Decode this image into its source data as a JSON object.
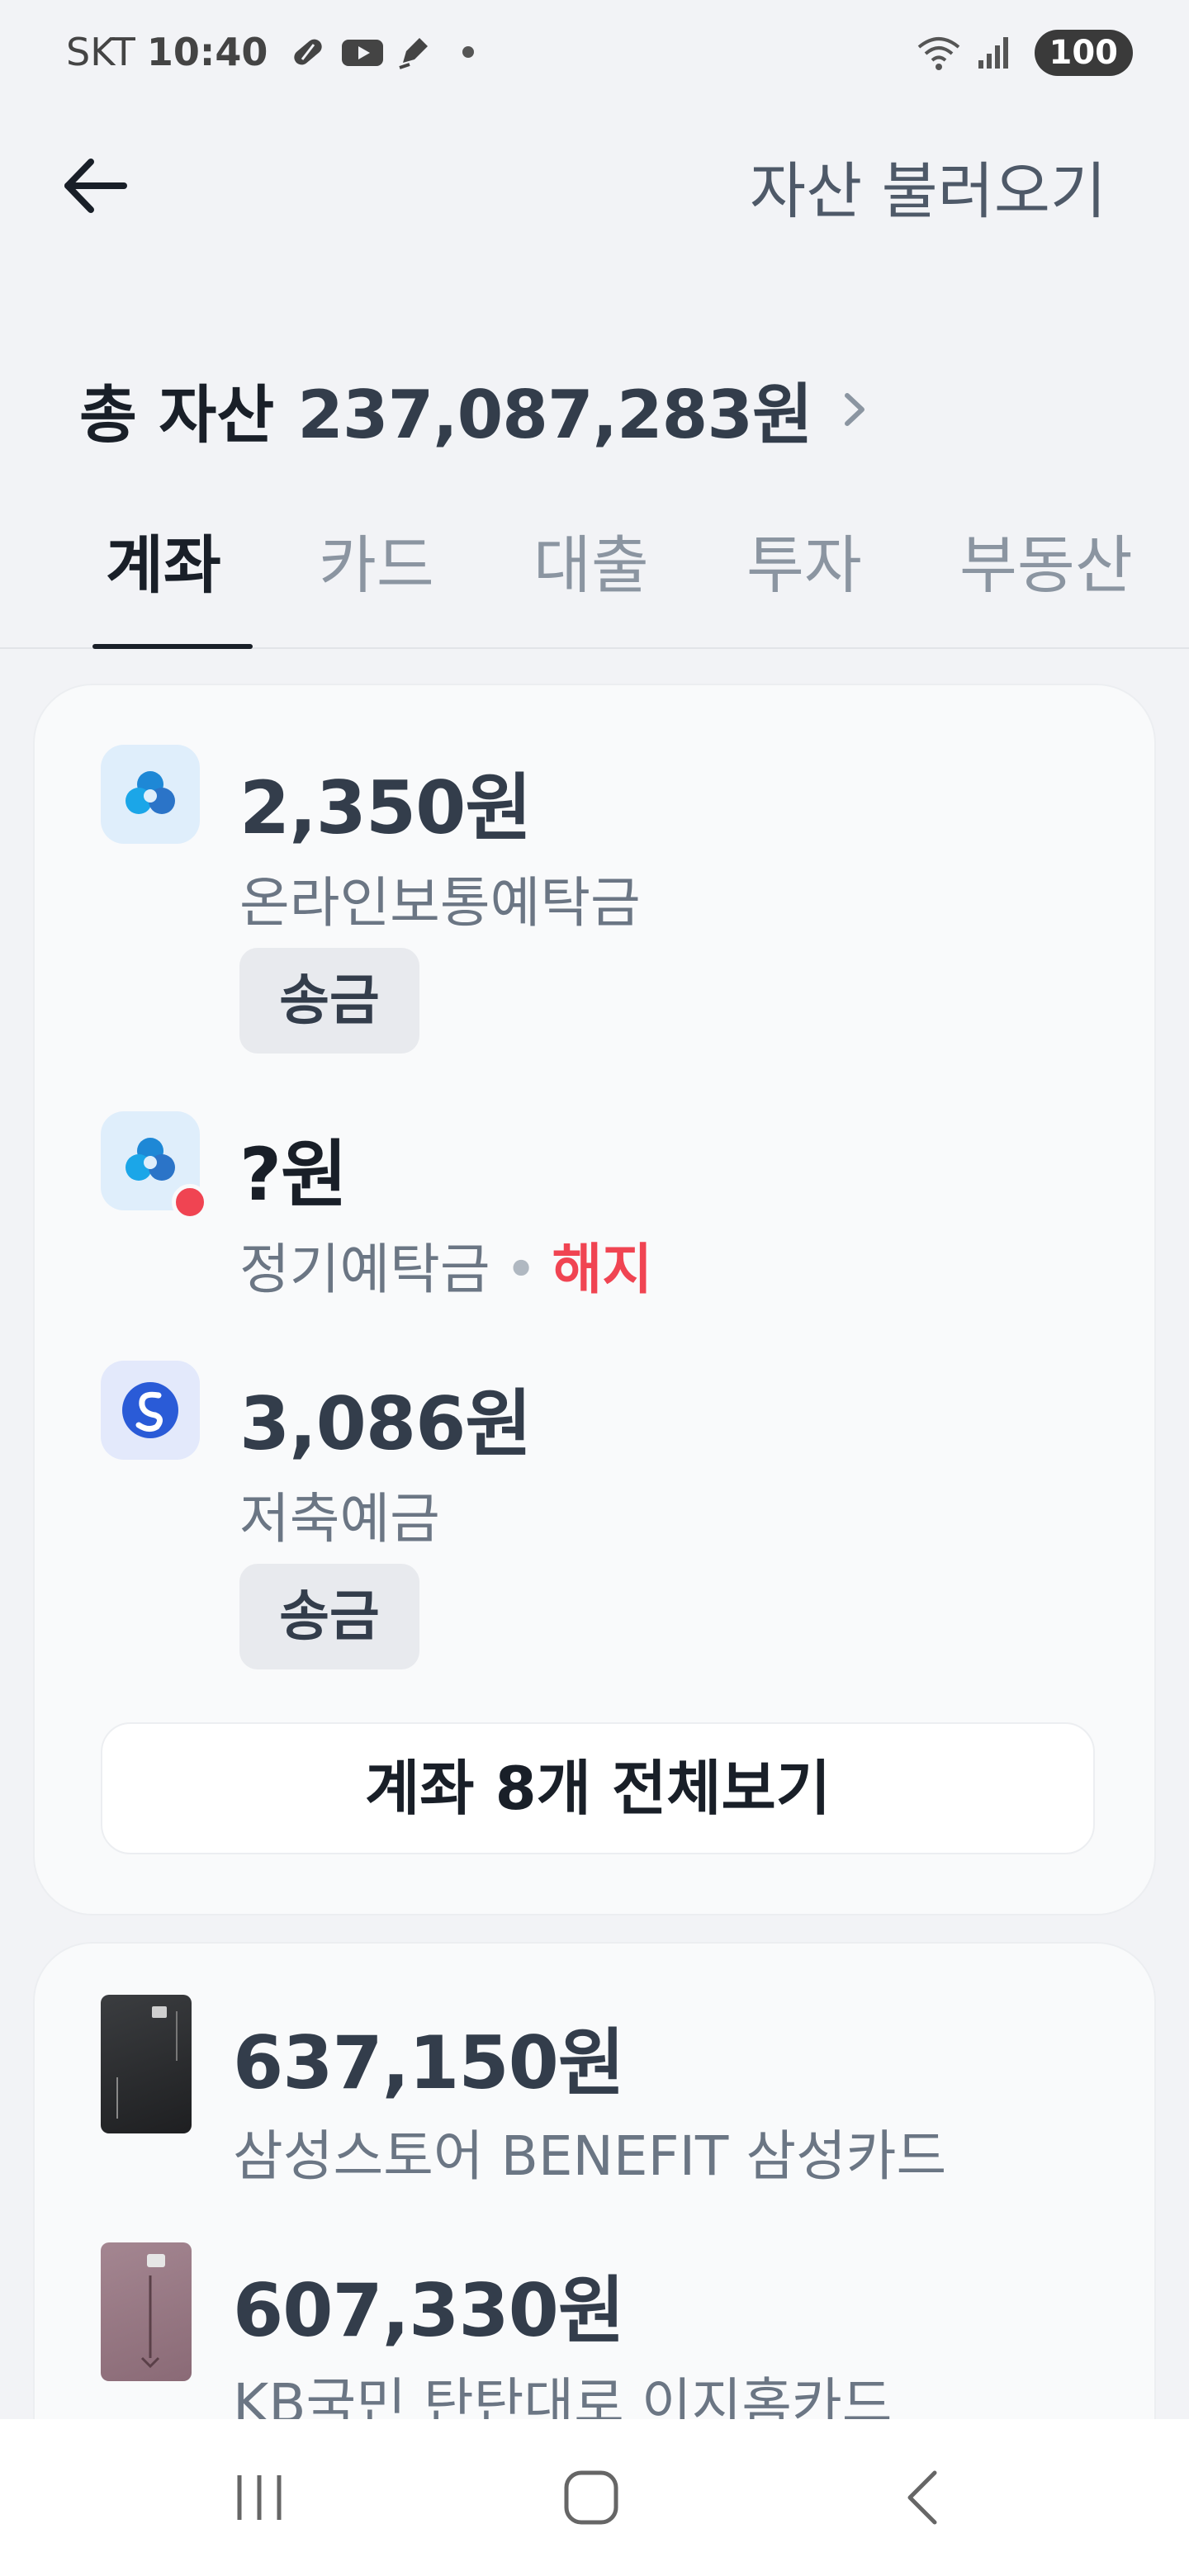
{
  "status_bar": {
    "carrier": "SKT",
    "time": "10:40",
    "battery": "100",
    "icons": [
      "pill-icon",
      "youtube-icon",
      "pen-icon",
      "wifi-icon",
      "signal-icon"
    ]
  },
  "header": {
    "back_icon": "arrow-left-icon",
    "import_label": "자산 불러오기"
  },
  "total": {
    "label": "총 자산",
    "value": "237,087,283원"
  },
  "tabs": [
    {
      "label": "계좌",
      "active": true
    },
    {
      "label": "카드",
      "active": false
    },
    {
      "label": "대출",
      "active": false
    },
    {
      "label": "투자",
      "active": false
    },
    {
      "label": "부동산",
      "active": false
    }
  ],
  "accounts": {
    "items": [
      {
        "amount": "2,350원",
        "name": "온라인보통예탁금",
        "button": "송금",
        "icon": "cloud-bank-icon"
      },
      {
        "amount": "?원",
        "name": "정기예탁금",
        "status": "해지",
        "icon": "cloud-bank-icon"
      },
      {
        "amount": "3,086원",
        "name": "저축예금",
        "button": "송금",
        "icon": "shinhan-bank-icon"
      }
    ],
    "view_all": "계좌 8개 전체보기"
  },
  "cards": {
    "items": [
      {
        "amount": "637,150원",
        "name": "삼성스토어 BENEFIT 삼성카드"
      },
      {
        "amount": "607,330원",
        "name": "KB국민 탄탄대로 이지홈카드"
      }
    ]
  },
  "colors": {
    "accent_red": "#f04452",
    "text_primary": "#191f28",
    "text_secondary": "#6b7684",
    "background": "#f2f3f6"
  },
  "nav": {
    "icons": [
      "recent-apps-icon",
      "home-icon",
      "back-icon"
    ]
  }
}
